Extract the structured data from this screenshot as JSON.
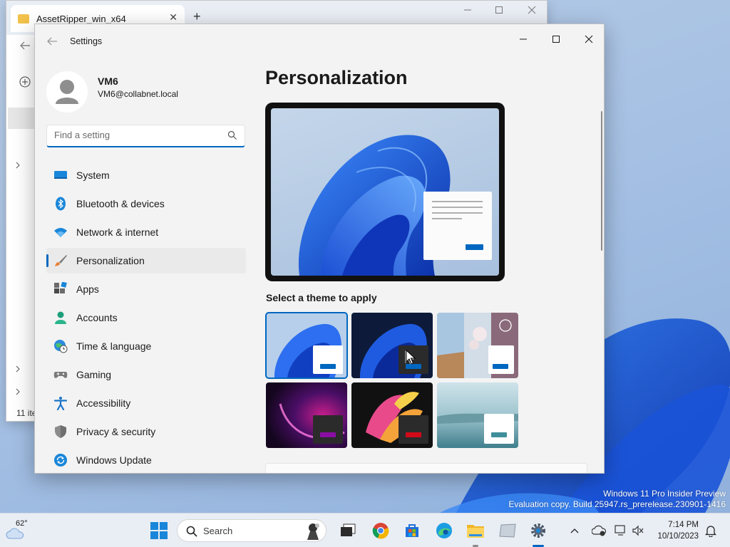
{
  "desktop": {
    "watermark_line1": "Windows 11 Pro Insider Preview",
    "watermark_line2": "Evaluation copy. Build 25947.rs_prerelease.230901-1416"
  },
  "explorer": {
    "tab_title": "AssetRipper_win_x64",
    "tab_close": "✕",
    "new_tab": "+",
    "status": "11 ite"
  },
  "settings": {
    "title": "Settings",
    "user": {
      "name": "VM6",
      "email": "VM6@collabnet.local"
    },
    "search": {
      "placeholder": "Find a setting"
    },
    "nav": [
      {
        "label": "System",
        "icon": "system-icon"
      },
      {
        "label": "Bluetooth & devices",
        "icon": "bluetooth-icon"
      },
      {
        "label": "Network & internet",
        "icon": "wifi-icon"
      },
      {
        "label": "Personalization",
        "icon": "brush-icon",
        "active": true
      },
      {
        "label": "Apps",
        "icon": "apps-icon"
      },
      {
        "label": "Accounts",
        "icon": "accounts-icon"
      },
      {
        "label": "Time & language",
        "icon": "globe-clock-icon"
      },
      {
        "label": "Gaming",
        "icon": "gamepad-icon"
      },
      {
        "label": "Accessibility",
        "icon": "accessibility-icon"
      },
      {
        "label": "Privacy & security",
        "icon": "shield-icon"
      },
      {
        "label": "Windows Update",
        "icon": "update-icon"
      }
    ],
    "page_title": "Personalization",
    "theme_label": "Select a theme to apply",
    "themes": [
      {
        "id": "windows-light",
        "selected": true,
        "accent": "#0067c0"
      },
      {
        "id": "windows-dark",
        "accent": "#0067c0"
      },
      {
        "id": "windows-spotlight",
        "accent": "#0067c0"
      },
      {
        "id": "glow",
        "accent": "#8a0ea3"
      },
      {
        "id": "captured-motion",
        "accent": "#d10a1a"
      },
      {
        "id": "flow",
        "accent": "#3f8f9a"
      }
    ],
    "accent_color": "#0067c0"
  },
  "taskbar": {
    "weather_temp": "62°",
    "search_label": "Search",
    "time": "7:14 PM",
    "date": "10/10/2023"
  }
}
